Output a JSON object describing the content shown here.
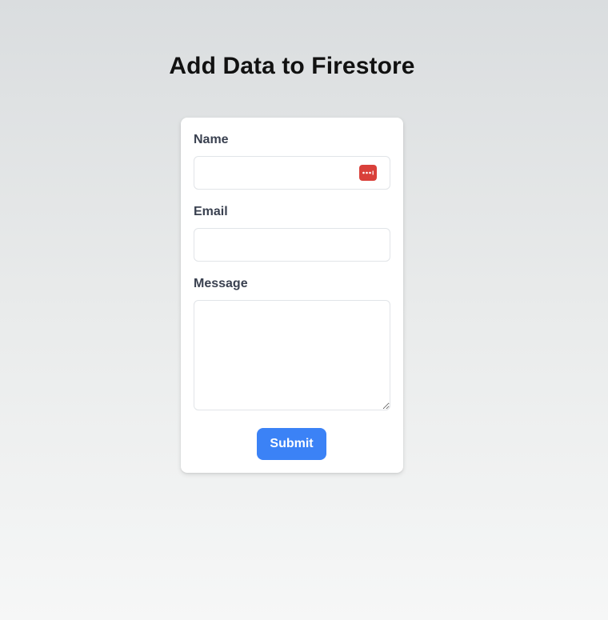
{
  "page": {
    "title": "Add Data to Firestore"
  },
  "form": {
    "name_label": "Name",
    "name_value": "",
    "email_label": "Email",
    "email_value": "",
    "message_label": "Message",
    "message_value": "",
    "submit_label": "Submit"
  },
  "icons": {
    "password_manager": "password-manager-icon"
  },
  "colors": {
    "accent": "#3b82f6",
    "password_manager_icon": "#d9403a",
    "label_text": "#3a4150",
    "title_text": "#111111"
  }
}
